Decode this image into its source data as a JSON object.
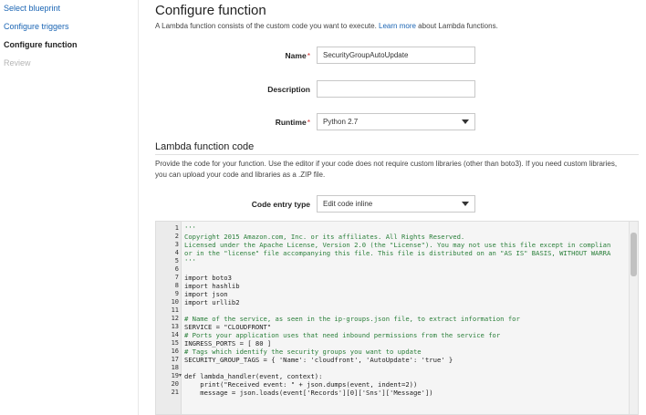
{
  "sidebar": {
    "items": [
      {
        "label": "Select blueprint"
      },
      {
        "label": "Configure triggers"
      },
      {
        "label": "Configure function"
      },
      {
        "label": "Review"
      }
    ]
  },
  "main": {
    "title": "Configure function",
    "intro_before": "A Lambda function consists of the custom code you want to execute. ",
    "intro_link": "Learn more",
    "intro_after": " about Lambda functions.",
    "name_label": "Name",
    "name_value": "SecurityGroupAutoUpdate",
    "description_label": "Description",
    "description_value": "",
    "runtime_label": "Runtime",
    "runtime_value": "Python 2.7",
    "required_mark": "*",
    "code_section_title": "Lambda function code",
    "code_section_desc": "Provide the code for your function. Use the editor if your code does not require custom libraries (other than boto3). If you need custom libraries, you can upload your code and libraries as a .ZIP file.",
    "code_entry_label": "Code entry type",
    "code_entry_value": "Edit code inline"
  },
  "editor": {
    "lines": [
      {
        "n": "1",
        "t": "'''"
      },
      {
        "n": "2",
        "t": "Copyright 2015 Amazon.com, Inc. or its affiliates. All Rights Reserved."
      },
      {
        "n": "3",
        "t": "Licensed under the Apache License, Version 2.0 (the \"License\"). You may not use this file except in complian"
      },
      {
        "n": "4",
        "t": "or in the \"license\" file accompanying this file. This file is distributed on an \"AS IS\" BASIS, WITHOUT WARRA"
      },
      {
        "n": "5",
        "t": "'''"
      },
      {
        "n": "6",
        "t": ""
      },
      {
        "n": "7",
        "t": "import boto3"
      },
      {
        "n": "8",
        "t": "import hashlib"
      },
      {
        "n": "9",
        "t": "import json"
      },
      {
        "n": "10",
        "t": "import urllib2"
      },
      {
        "n": "11",
        "t": ""
      },
      {
        "n": "12",
        "t": "# Name of the service, as seen in the ip-groups.json file, to extract information for"
      },
      {
        "n": "13",
        "t": "SERVICE = \"CLOUDFRONT\""
      },
      {
        "n": "14",
        "t": "# Ports your application uses that need inbound permissions from the service for"
      },
      {
        "n": "15",
        "t": "INGRESS_PORTS = [ 80 ]"
      },
      {
        "n": "16",
        "t": "# Tags which identify the security groups you want to update"
      },
      {
        "n": "17",
        "t": "SECURITY_GROUP_TAGS = { 'Name': 'cloudfront', 'AutoUpdate': 'true' }"
      },
      {
        "n": "18",
        "t": ""
      },
      {
        "n": "19",
        "t": "def lambda_handler(event, context):",
        "fold": "▾"
      },
      {
        "n": "20",
        "t": "    print(\"Received event: \" + json.dumps(event, indent=2))"
      },
      {
        "n": "21",
        "t": "    message = json.loads(event['Records'][0]['Sns']['Message'])"
      }
    ]
  }
}
